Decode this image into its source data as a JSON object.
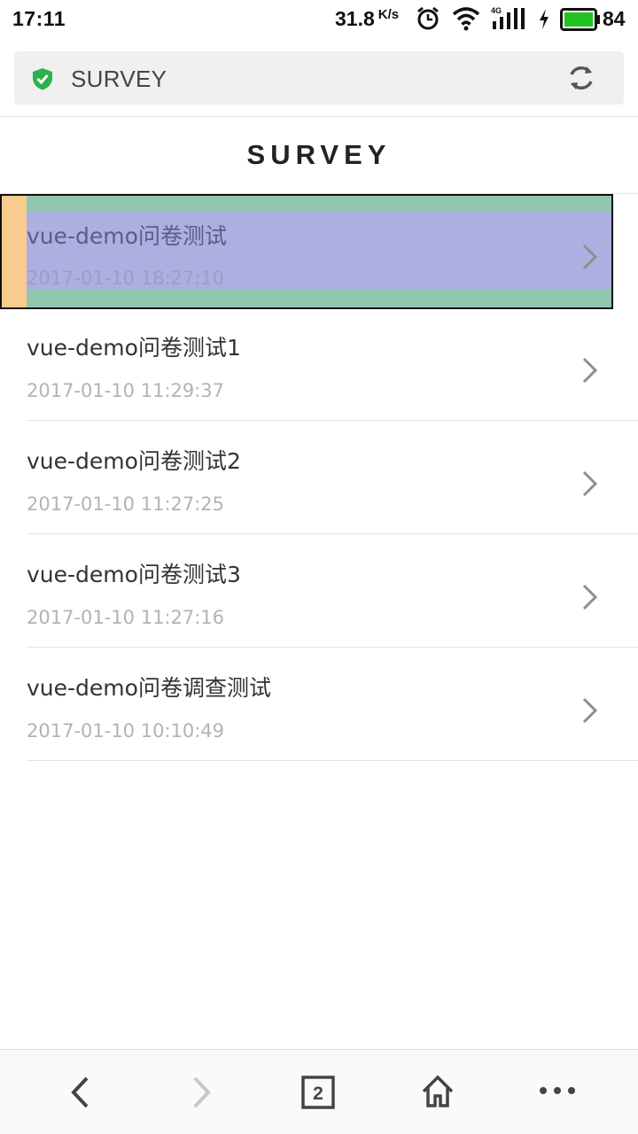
{
  "status_bar": {
    "time": "17:11",
    "network_speed": "31.8",
    "network_speed_unit": "K/s",
    "battery_percent": "84",
    "icons": [
      "alarm-icon",
      "wifi-icon",
      "signal-4g-icon",
      "charging-icon",
      "battery-icon"
    ]
  },
  "browser": {
    "url_text": "SURVEY",
    "secure_icon": "shield-check-icon",
    "refresh_icon": "refresh-icon",
    "tab_count": "2"
  },
  "page": {
    "title": "SURVEY"
  },
  "surveys": [
    {
      "title": "vue-demo问卷测试",
      "date": "2017-01-10 18:27:10"
    },
    {
      "title": "vue-demo问卷测试1",
      "date": "2017-01-10 11:29:37"
    },
    {
      "title": "vue-demo问卷测试2",
      "date": "2017-01-10 11:27:25"
    },
    {
      "title": "vue-demo问卷测试3",
      "date": "2017-01-10 11:27:16"
    },
    {
      "title": "vue-demo问卷调查测试",
      "date": "2017-01-10 10:10:49"
    }
  ],
  "colors": {
    "secure_green": "#2bb24c",
    "battery_green": "#22c322",
    "highlight_margin": "#f8cb8f",
    "highlight_padding": "#91c6b0",
    "highlight_content": "#adafe0"
  }
}
